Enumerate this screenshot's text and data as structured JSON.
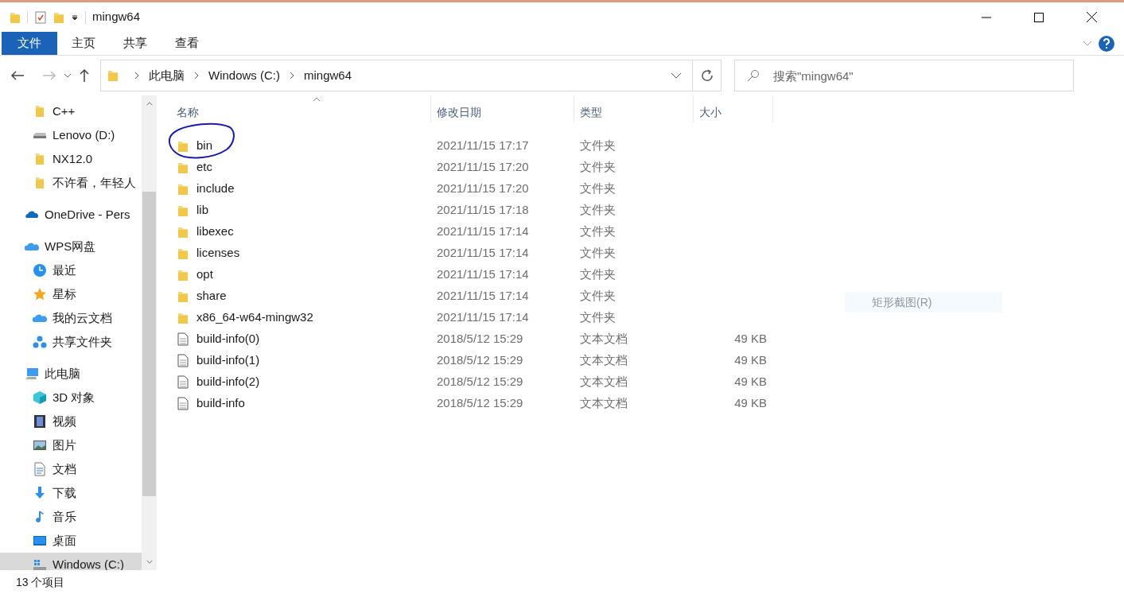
{
  "window": {
    "title": "mingw64"
  },
  "ribbon_tabs": [
    {
      "label": "文件",
      "selected": true
    },
    {
      "label": "主页",
      "selected": false
    },
    {
      "label": "共享",
      "selected": false
    },
    {
      "label": "查看",
      "selected": false
    }
  ],
  "breadcrumb": [
    "此电脑",
    "Windows (C:)",
    "mingw64"
  ],
  "search": {
    "placeholder": "搜索\"mingw64\""
  },
  "sidebar": {
    "items": [
      {
        "label": "C++",
        "kind": "folder",
        "group": false,
        "selected": false
      },
      {
        "label": "Lenovo (D:)",
        "kind": "drive",
        "group": false,
        "selected": false
      },
      {
        "label": "NX12.0",
        "kind": "folder",
        "group": false,
        "selected": false
      },
      {
        "label": "不许看，年轻人",
        "kind": "folder",
        "group": false,
        "selected": false
      },
      {
        "label": "OneDrive - Pers",
        "kind": "onedrive",
        "group": true,
        "selected": false
      },
      {
        "label": "WPS网盘",
        "kind": "cloud",
        "group": true,
        "selected": false
      },
      {
        "label": "最近",
        "kind": "clock",
        "group": false,
        "selected": false
      },
      {
        "label": "星标",
        "kind": "star",
        "group": false,
        "selected": false
      },
      {
        "label": "我的云文档",
        "kind": "cloud",
        "group": false,
        "selected": false
      },
      {
        "label": "共享文件夹",
        "kind": "share",
        "group": false,
        "selected": false
      },
      {
        "label": "此电脑",
        "kind": "pc",
        "group": true,
        "selected": false
      },
      {
        "label": "3D 对象",
        "kind": "cube",
        "group": false,
        "selected": false
      },
      {
        "label": "视频",
        "kind": "video",
        "group": false,
        "selected": false
      },
      {
        "label": "图片",
        "kind": "image",
        "group": false,
        "selected": false
      },
      {
        "label": "文档",
        "kind": "doc",
        "group": false,
        "selected": false
      },
      {
        "label": "下载",
        "kind": "download",
        "group": false,
        "selected": false
      },
      {
        "label": "音乐",
        "kind": "music",
        "group": false,
        "selected": false
      },
      {
        "label": "桌面",
        "kind": "desktop",
        "group": false,
        "selected": false
      },
      {
        "label": "Windows (C:)",
        "kind": "windrive",
        "group": false,
        "selected": true
      }
    ]
  },
  "table": {
    "columns": [
      "名称",
      "修改日期",
      "类型",
      "大小"
    ],
    "rows": [
      {
        "name": "bin",
        "date": "2021/11/15 17:17",
        "type": "文件夹",
        "kind": "folder",
        "circled": true
      },
      {
        "name": "etc",
        "date": "2021/11/15 17:20",
        "type": "文件夹",
        "kind": "folder",
        "circled": false
      },
      {
        "name": "include",
        "date": "2021/11/15 17:20",
        "type": "文件夹",
        "kind": "folder",
        "circled": false
      },
      {
        "name": "lib",
        "date": "2021/11/15 17:18",
        "type": "文件夹",
        "kind": "folder",
        "circled": false
      },
      {
        "name": "libexec",
        "date": "2021/11/15 17:14",
        "type": "文件夹",
        "kind": "folder",
        "circled": false
      },
      {
        "name": "licenses",
        "date": "2021/11/15 17:14",
        "type": "文件夹",
        "kind": "folder",
        "circled": false
      },
      {
        "name": "opt",
        "date": "2021/11/15 17:14",
        "type": "文件夹",
        "kind": "folder",
        "circled": false
      },
      {
        "name": "share",
        "date": "2021/11/15 17:14",
        "type": "文件夹",
        "kind": "folder",
        "circled": false
      },
      {
        "name": "x86_64-w64-mingw32",
        "date": "2021/11/15 17:14",
        "type": "文件夹",
        "kind": "folder",
        "circled": false
      },
      {
        "name": "build-info(0)",
        "date": "2018/5/12 15:29",
        "type": "文本文档",
        "size": "49 KB",
        "kind": "file",
        "circled": false
      },
      {
        "name": "build-info(1)",
        "date": "2018/5/12 15:29",
        "type": "文本文档",
        "size": "49 KB",
        "kind": "file",
        "circled": false
      },
      {
        "name": "build-info(2)",
        "date": "2018/5/12 15:29",
        "type": "文本文档",
        "size": "49 KB",
        "kind": "file",
        "circled": false
      },
      {
        "name": "build-info",
        "date": "2018/5/12 15:29",
        "type": "文本文档",
        "size": "49 KB",
        "kind": "file",
        "circled": false
      }
    ]
  },
  "ghost_menu": {
    "label": "矩形截图(R)"
  },
  "status_bar": {
    "count": "13 个项目"
  }
}
